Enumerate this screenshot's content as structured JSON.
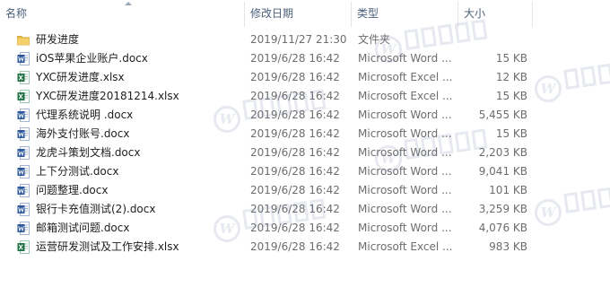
{
  "columns": {
    "name": "名称",
    "date": "修改日期",
    "type": "类型",
    "size": "大小"
  },
  "files": [
    {
      "name": "研发进度",
      "date": "2019/11/27 21:30",
      "type": "文件夹",
      "size": "",
      "icon": "folder-icon"
    },
    {
      "name": "iOS苹果企业账户.docx",
      "date": "2019/6/28 16:42",
      "type": "Microsoft Word ...",
      "size": "15 KB",
      "icon": "word-document-icon"
    },
    {
      "name": "YXC研发进度.xlsx",
      "date": "2019/6/28 16:42",
      "type": "Microsoft Excel ...",
      "size": "12 KB",
      "icon": "excel-workbook-icon"
    },
    {
      "name": "YXC研发进度20181214.xlsx",
      "date": "2019/6/28 16:42",
      "type": "Microsoft Excel ...",
      "size": "15 KB",
      "icon": "excel-workbook-icon"
    },
    {
      "name": "代理系统说明 .docx",
      "date": "2019/6/28 16:42",
      "type": "Microsoft Word ...",
      "size": "5,455 KB",
      "icon": "word-document-icon"
    },
    {
      "name": "海外支付账号.docx",
      "date": "2019/6/28 16:42",
      "type": "Microsoft Word ...",
      "size": "15 KB",
      "icon": "word-document-icon"
    },
    {
      "name": "龙虎斗策划文档.docx",
      "date": "2019/6/28 16:42",
      "type": "Microsoft Word ...",
      "size": "2,203 KB",
      "icon": "word-document-icon"
    },
    {
      "name": "上下分测试.docx",
      "date": "2019/6/28 16:42",
      "type": "Microsoft Word ...",
      "size": "9,041 KB",
      "icon": "word-document-icon"
    },
    {
      "name": "问题整理.docx",
      "date": "2019/6/28 16:42",
      "type": "Microsoft Word ...",
      "size": "101 KB",
      "icon": "word-document-icon"
    },
    {
      "name": "银行卡充值测试(2).docx",
      "date": "2019/6/28 16:42",
      "type": "Microsoft Word ...",
      "size": "3,259 KB",
      "icon": "word-document-icon"
    },
    {
      "name": "邮箱测试问题.docx",
      "date": "2019/6/28 16:42",
      "type": "Microsoft Word ...",
      "size": "4,076 KB",
      "icon": "word-document-icon"
    },
    {
      "name": "运营研发测试及工作安排.xlsx",
      "date": "2019/6/28 16:42",
      "type": "Microsoft Excel ...",
      "size": "983 KB",
      "icon": "excel-workbook-icon"
    }
  ],
  "colors": {
    "header_text": "#4c607a",
    "name_text": "#1e1e1e",
    "detail_text": "#6d6d6d",
    "folder": "#e8b93f",
    "word": "#2b579a",
    "excel": "#217346"
  },
  "watermark_icon": "watermark-logo-icon"
}
